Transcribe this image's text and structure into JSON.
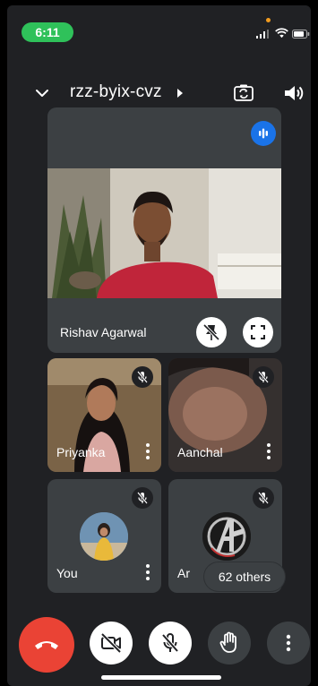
{
  "status_bar": {
    "time": "6:11",
    "icons": [
      "signal-icon",
      "wifi-icon",
      "battery-icon"
    ]
  },
  "header": {
    "meeting_code": "rzz-byix-cvz",
    "icons": [
      "chevron-down-icon",
      "caret-right-icon",
      "switch-camera-icon",
      "speaker-icon"
    ]
  },
  "main_tile": {
    "name": "Rishav Agarwal",
    "icons": [
      "speaking-icon",
      "unpin-icon",
      "fullscreen-icon"
    ]
  },
  "tiles": [
    {
      "name": "Priyanka",
      "muted": true
    },
    {
      "name": "Aanchal",
      "muted": true
    },
    {
      "name": "You",
      "muted": true
    },
    {
      "name": "Ar",
      "muted": true
    }
  ],
  "others_label": "62 others",
  "controls": [
    "end-call-icon",
    "camera-off-icon",
    "mic-off-icon",
    "raise-hand-icon",
    "more-vert-icon"
  ],
  "colors": {
    "end_call": "#ea4335",
    "speaking": "#1a73e8",
    "time_pill": "#2fc15a",
    "background": "#202124",
    "tile": "#3c4043"
  }
}
